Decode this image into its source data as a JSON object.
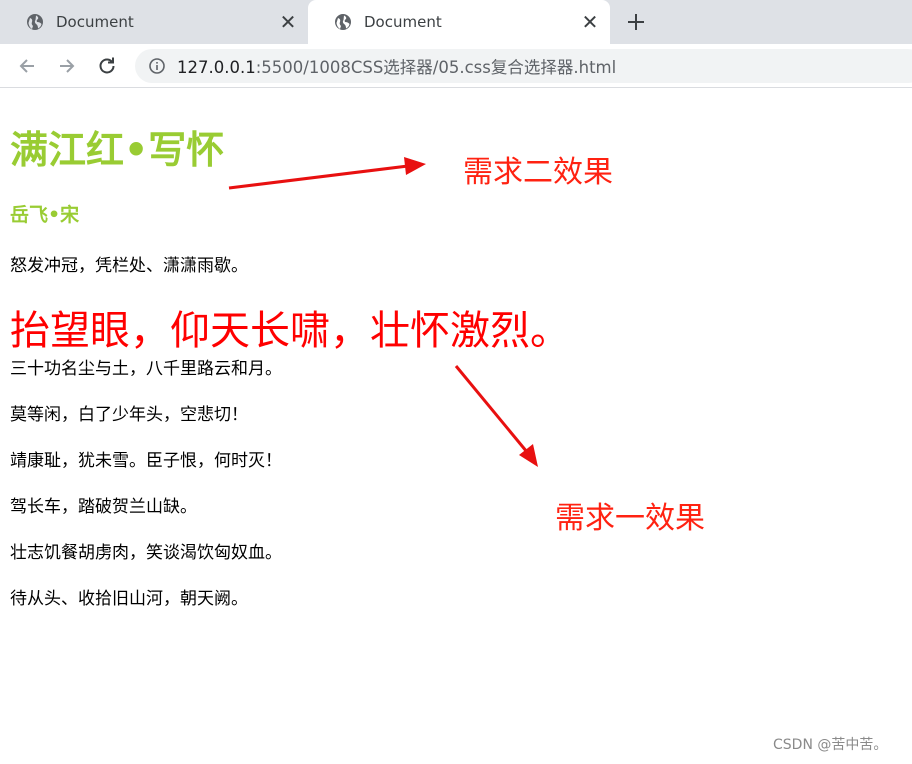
{
  "browser": {
    "tabs": [
      {
        "title": "Document",
        "active": false
      },
      {
        "title": "Document",
        "active": true
      }
    ],
    "url_host": "127.0.0.1",
    "url_rest": ":5500/1008CSS选择器/05.css复合选择器.html",
    "icons": {
      "tab_favicon": "globe-icon",
      "close": "close-icon",
      "new_tab": "plus-icon",
      "back": "back-arrow-icon",
      "forward": "forward-arrow-icon",
      "reload": "reload-icon",
      "site_info": "info-icon"
    }
  },
  "page": {
    "title": "满江红•写怀",
    "author": "岳飞•宋",
    "lines": [
      "怒发冲冠，凭栏处、潇潇雨歇。",
      "抬望眼，仰天长啸，壮怀激烈。",
      "三十功名尘与土，八千里路云和月。",
      "莫等闲，白了少年头，空悲切！",
      "靖康耻，犹未雪。臣子恨，何时灭！",
      "驾长车，踏破贺兰山缺。",
      "壮志饥餐胡虏肉，笑谈渴饮匈奴血。",
      "待从头、收拾旧山河，朝天阙。"
    ],
    "colors": {
      "heading": "#99cc33",
      "highlight": "#ff0000",
      "annotation": "#ff2211"
    }
  },
  "annotations": {
    "requirement_two": "需求二效果",
    "requirement_one": "需求一效果"
  },
  "watermark": "CSDN @苦中苦。"
}
